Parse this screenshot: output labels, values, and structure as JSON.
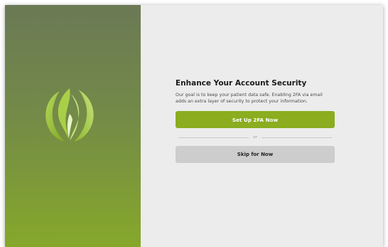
{
  "brand": {
    "logo_icon": "leaf-flame-icon",
    "panel_gradient_top": "#6b7955",
    "panel_gradient_bottom": "#86a82a",
    "logo_color": "#9cc43a"
  },
  "security_prompt": {
    "heading": "Enhance Your Account Security",
    "description": "Our goal is to keep your patient data safe. Enabling 2FA via email adds an extra layer of security to protect your information.",
    "setup_button_label": "Set Up 2FA Now",
    "setup_button_color": "#8bad1f",
    "divider_text": "or",
    "skip_button_label": "Skip for Now",
    "skip_button_color": "#cdcdcd"
  }
}
